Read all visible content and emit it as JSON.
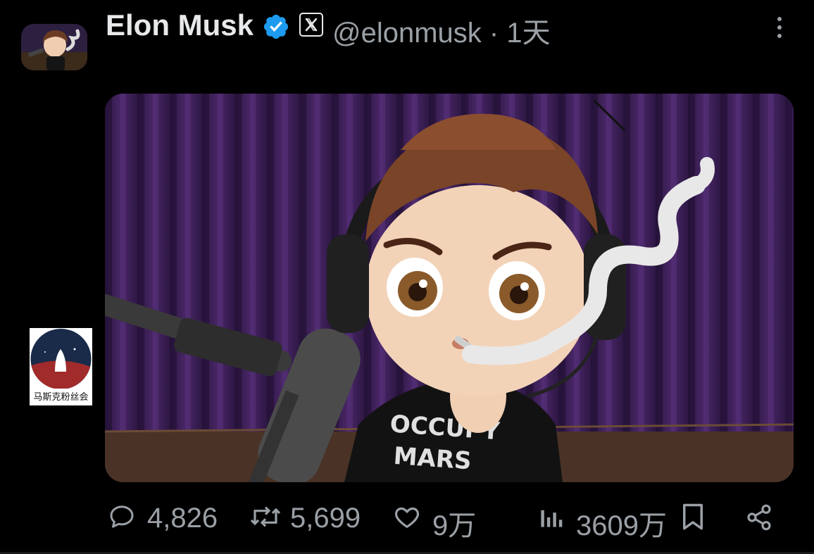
{
  "author": {
    "name": "Elon Musk",
    "handle": "@elonmusk",
    "separator": "·",
    "time": "1天",
    "verified_icon": "verified-badge-icon",
    "platform_icon": "x-logo-icon"
  },
  "media": {
    "shirt_text_line1": "OCCUPY",
    "shirt_text_line2": "MARS"
  },
  "watermark": {
    "label": "马斯克粉丝会"
  },
  "actions": {
    "replies": "4,826",
    "reposts": "5,699",
    "likes": "9万",
    "views": "3609万"
  },
  "colors": {
    "background": "#000000",
    "text_primary": "#e7e9ea",
    "text_secondary": "#9aa0a6",
    "verified": "#1d9bf0",
    "curtain": "#3a1e52"
  }
}
